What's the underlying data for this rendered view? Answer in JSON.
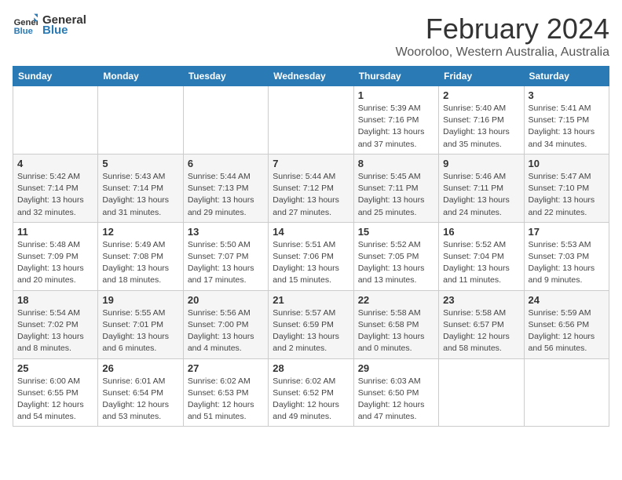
{
  "logo": {
    "text_general": "General",
    "text_blue": "Blue"
  },
  "header": {
    "title": "February 2024",
    "subtitle": "Wooroloo, Western Australia, Australia"
  },
  "weekdays": [
    "Sunday",
    "Monday",
    "Tuesday",
    "Wednesday",
    "Thursday",
    "Friday",
    "Saturday"
  ],
  "weeks": [
    [
      {
        "day": "",
        "info": ""
      },
      {
        "day": "",
        "info": ""
      },
      {
        "day": "",
        "info": ""
      },
      {
        "day": "",
        "info": ""
      },
      {
        "day": "1",
        "info": "Sunrise: 5:39 AM\nSunset: 7:16 PM\nDaylight: 13 hours\nand 37 minutes."
      },
      {
        "day": "2",
        "info": "Sunrise: 5:40 AM\nSunset: 7:16 PM\nDaylight: 13 hours\nand 35 minutes."
      },
      {
        "day": "3",
        "info": "Sunrise: 5:41 AM\nSunset: 7:15 PM\nDaylight: 13 hours\nand 34 minutes."
      }
    ],
    [
      {
        "day": "4",
        "info": "Sunrise: 5:42 AM\nSunset: 7:14 PM\nDaylight: 13 hours\nand 32 minutes."
      },
      {
        "day": "5",
        "info": "Sunrise: 5:43 AM\nSunset: 7:14 PM\nDaylight: 13 hours\nand 31 minutes."
      },
      {
        "day": "6",
        "info": "Sunrise: 5:44 AM\nSunset: 7:13 PM\nDaylight: 13 hours\nand 29 minutes."
      },
      {
        "day": "7",
        "info": "Sunrise: 5:44 AM\nSunset: 7:12 PM\nDaylight: 13 hours\nand 27 minutes."
      },
      {
        "day": "8",
        "info": "Sunrise: 5:45 AM\nSunset: 7:11 PM\nDaylight: 13 hours\nand 25 minutes."
      },
      {
        "day": "9",
        "info": "Sunrise: 5:46 AM\nSunset: 7:11 PM\nDaylight: 13 hours\nand 24 minutes."
      },
      {
        "day": "10",
        "info": "Sunrise: 5:47 AM\nSunset: 7:10 PM\nDaylight: 13 hours\nand 22 minutes."
      }
    ],
    [
      {
        "day": "11",
        "info": "Sunrise: 5:48 AM\nSunset: 7:09 PM\nDaylight: 13 hours\nand 20 minutes."
      },
      {
        "day": "12",
        "info": "Sunrise: 5:49 AM\nSunset: 7:08 PM\nDaylight: 13 hours\nand 18 minutes."
      },
      {
        "day": "13",
        "info": "Sunrise: 5:50 AM\nSunset: 7:07 PM\nDaylight: 13 hours\nand 17 minutes."
      },
      {
        "day": "14",
        "info": "Sunrise: 5:51 AM\nSunset: 7:06 PM\nDaylight: 13 hours\nand 15 minutes."
      },
      {
        "day": "15",
        "info": "Sunrise: 5:52 AM\nSunset: 7:05 PM\nDaylight: 13 hours\nand 13 minutes."
      },
      {
        "day": "16",
        "info": "Sunrise: 5:52 AM\nSunset: 7:04 PM\nDaylight: 13 hours\nand 11 minutes."
      },
      {
        "day": "17",
        "info": "Sunrise: 5:53 AM\nSunset: 7:03 PM\nDaylight: 13 hours\nand 9 minutes."
      }
    ],
    [
      {
        "day": "18",
        "info": "Sunrise: 5:54 AM\nSunset: 7:02 PM\nDaylight: 13 hours\nand 8 minutes."
      },
      {
        "day": "19",
        "info": "Sunrise: 5:55 AM\nSunset: 7:01 PM\nDaylight: 13 hours\nand 6 minutes."
      },
      {
        "day": "20",
        "info": "Sunrise: 5:56 AM\nSunset: 7:00 PM\nDaylight: 13 hours\nand 4 minutes."
      },
      {
        "day": "21",
        "info": "Sunrise: 5:57 AM\nSunset: 6:59 PM\nDaylight: 13 hours\nand 2 minutes."
      },
      {
        "day": "22",
        "info": "Sunrise: 5:58 AM\nSunset: 6:58 PM\nDaylight: 13 hours\nand 0 minutes."
      },
      {
        "day": "23",
        "info": "Sunrise: 5:58 AM\nSunset: 6:57 PM\nDaylight: 12 hours\nand 58 minutes."
      },
      {
        "day": "24",
        "info": "Sunrise: 5:59 AM\nSunset: 6:56 PM\nDaylight: 12 hours\nand 56 minutes."
      }
    ],
    [
      {
        "day": "25",
        "info": "Sunrise: 6:00 AM\nSunset: 6:55 PM\nDaylight: 12 hours\nand 54 minutes."
      },
      {
        "day": "26",
        "info": "Sunrise: 6:01 AM\nSunset: 6:54 PM\nDaylight: 12 hours\nand 53 minutes."
      },
      {
        "day": "27",
        "info": "Sunrise: 6:02 AM\nSunset: 6:53 PM\nDaylight: 12 hours\nand 51 minutes."
      },
      {
        "day": "28",
        "info": "Sunrise: 6:02 AM\nSunset: 6:52 PM\nDaylight: 12 hours\nand 49 minutes."
      },
      {
        "day": "29",
        "info": "Sunrise: 6:03 AM\nSunset: 6:50 PM\nDaylight: 12 hours\nand 47 minutes."
      },
      {
        "day": "",
        "info": ""
      },
      {
        "day": "",
        "info": ""
      }
    ]
  ]
}
